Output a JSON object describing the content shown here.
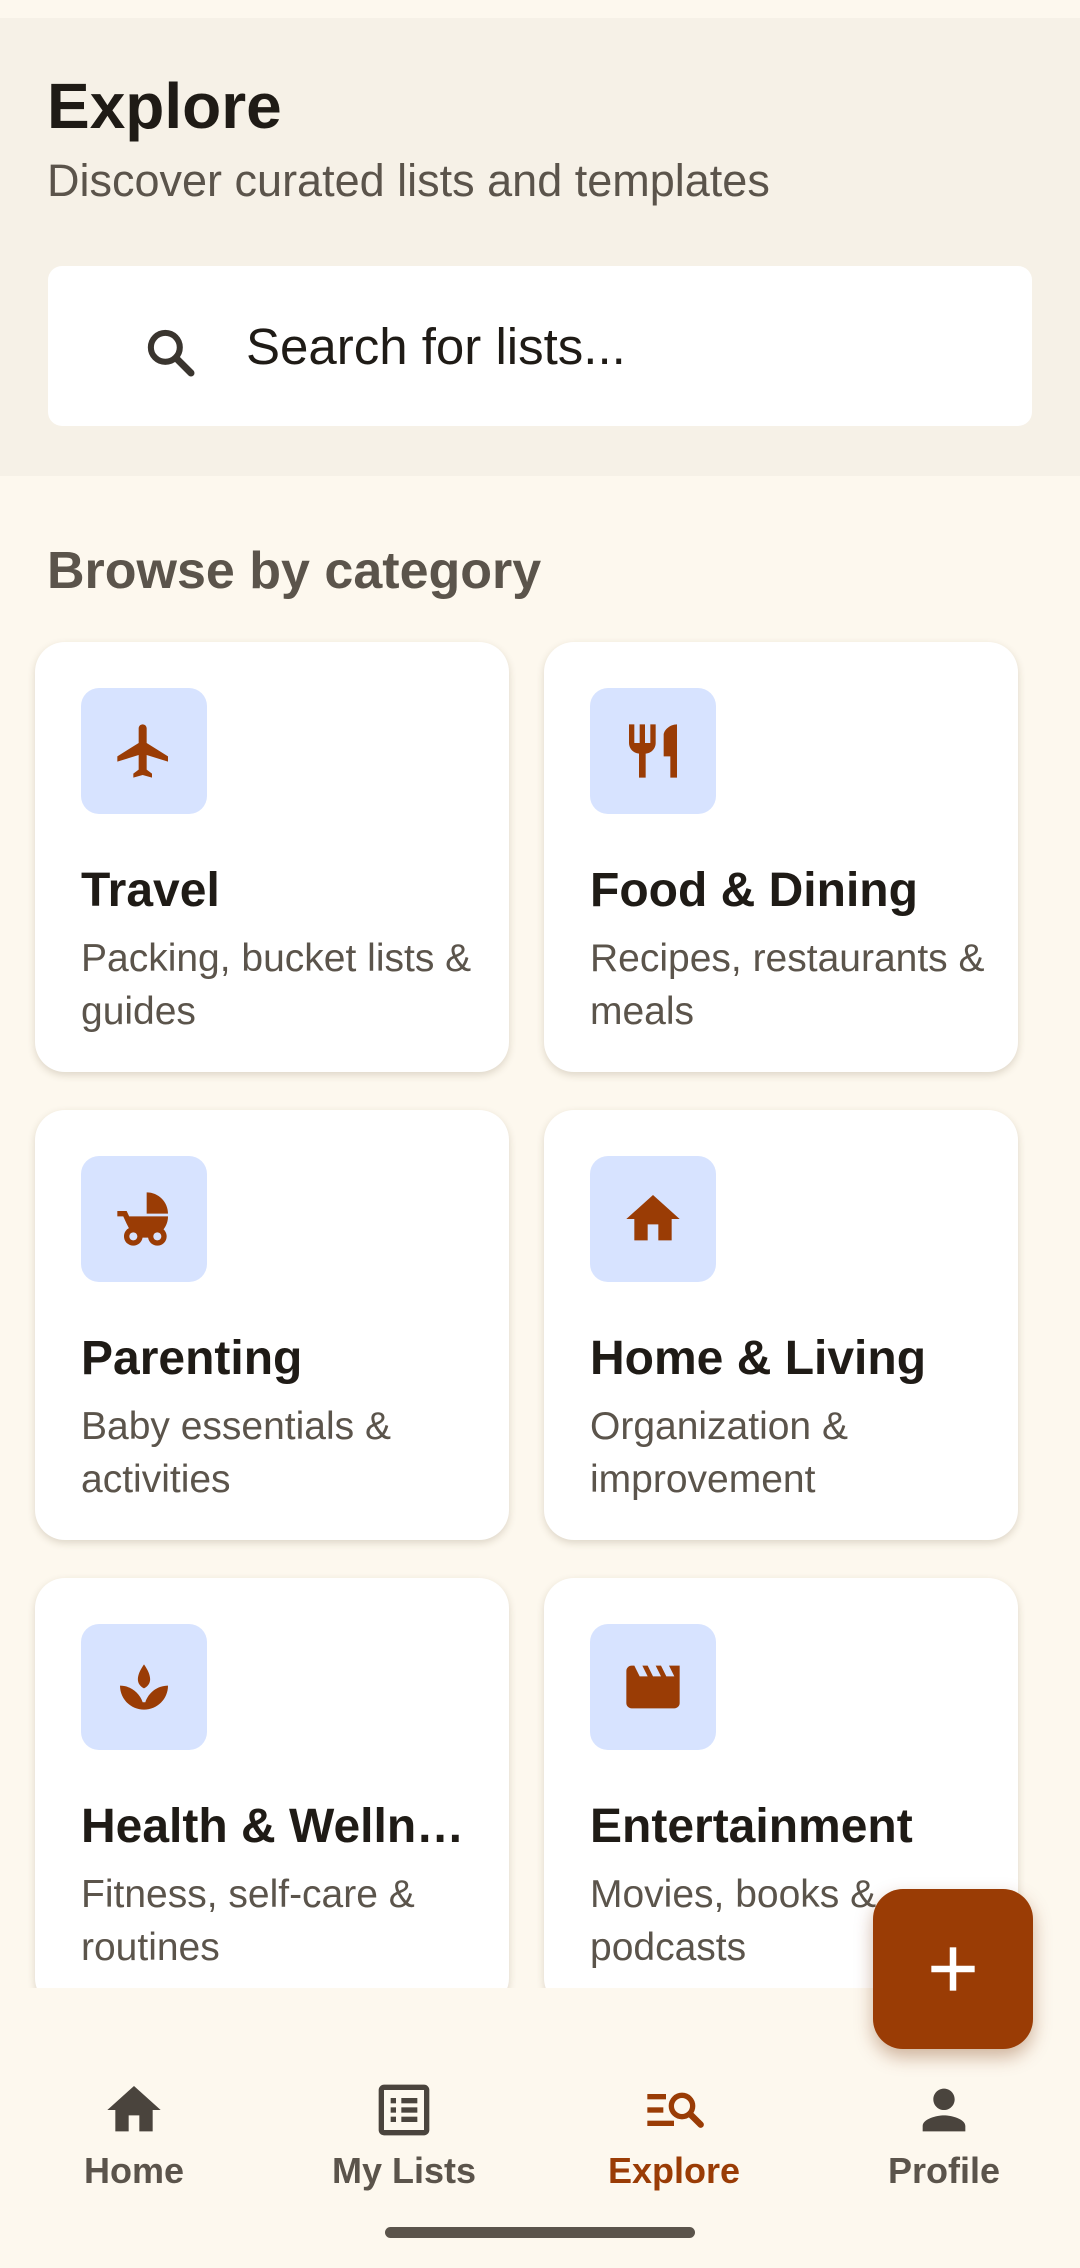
{
  "header": {
    "title": "Explore",
    "subtitle": "Discover curated lists and templates"
  },
  "search": {
    "placeholder": "Search for lists..."
  },
  "browse": {
    "section_title": "Browse by category",
    "categories": [
      {
        "title": "Travel",
        "description": "Packing, bucket lists & guides",
        "icon": "airplane-icon"
      },
      {
        "title": "Food & Dining",
        "description": "Recipes, restaurants & meals",
        "icon": "fork-knife-icon"
      },
      {
        "title": "Parenting",
        "description": "Baby essentials & activities",
        "icon": "stroller-icon"
      },
      {
        "title": "Home & Living",
        "description": "Organization & improvement",
        "icon": "house-icon"
      },
      {
        "title": "Health & Wellness",
        "description": "Fitness, self-care & routines",
        "icon": "lotus-icon"
      },
      {
        "title": "Entertainment",
        "description": "Movies, books & podcasts",
        "icon": "clapperboard-icon"
      }
    ]
  },
  "fab": {
    "icon": "plus-icon"
  },
  "nav": {
    "items": [
      {
        "label": "Home",
        "icon": "home-icon",
        "active": false
      },
      {
        "label": "My Lists",
        "icon": "list-icon",
        "active": false
      },
      {
        "label": "Explore",
        "icon": "explore-search-icon",
        "active": true
      },
      {
        "label": "Profile",
        "icon": "person-icon",
        "active": false
      }
    ]
  },
  "colors": {
    "accent": "#9a3c05",
    "background": "#fdf8ee",
    "header_background": "#f6f1e7",
    "icon_tile": "#d7e3ff",
    "text_primary": "#1f1b16",
    "text_secondary": "#5b544b"
  }
}
